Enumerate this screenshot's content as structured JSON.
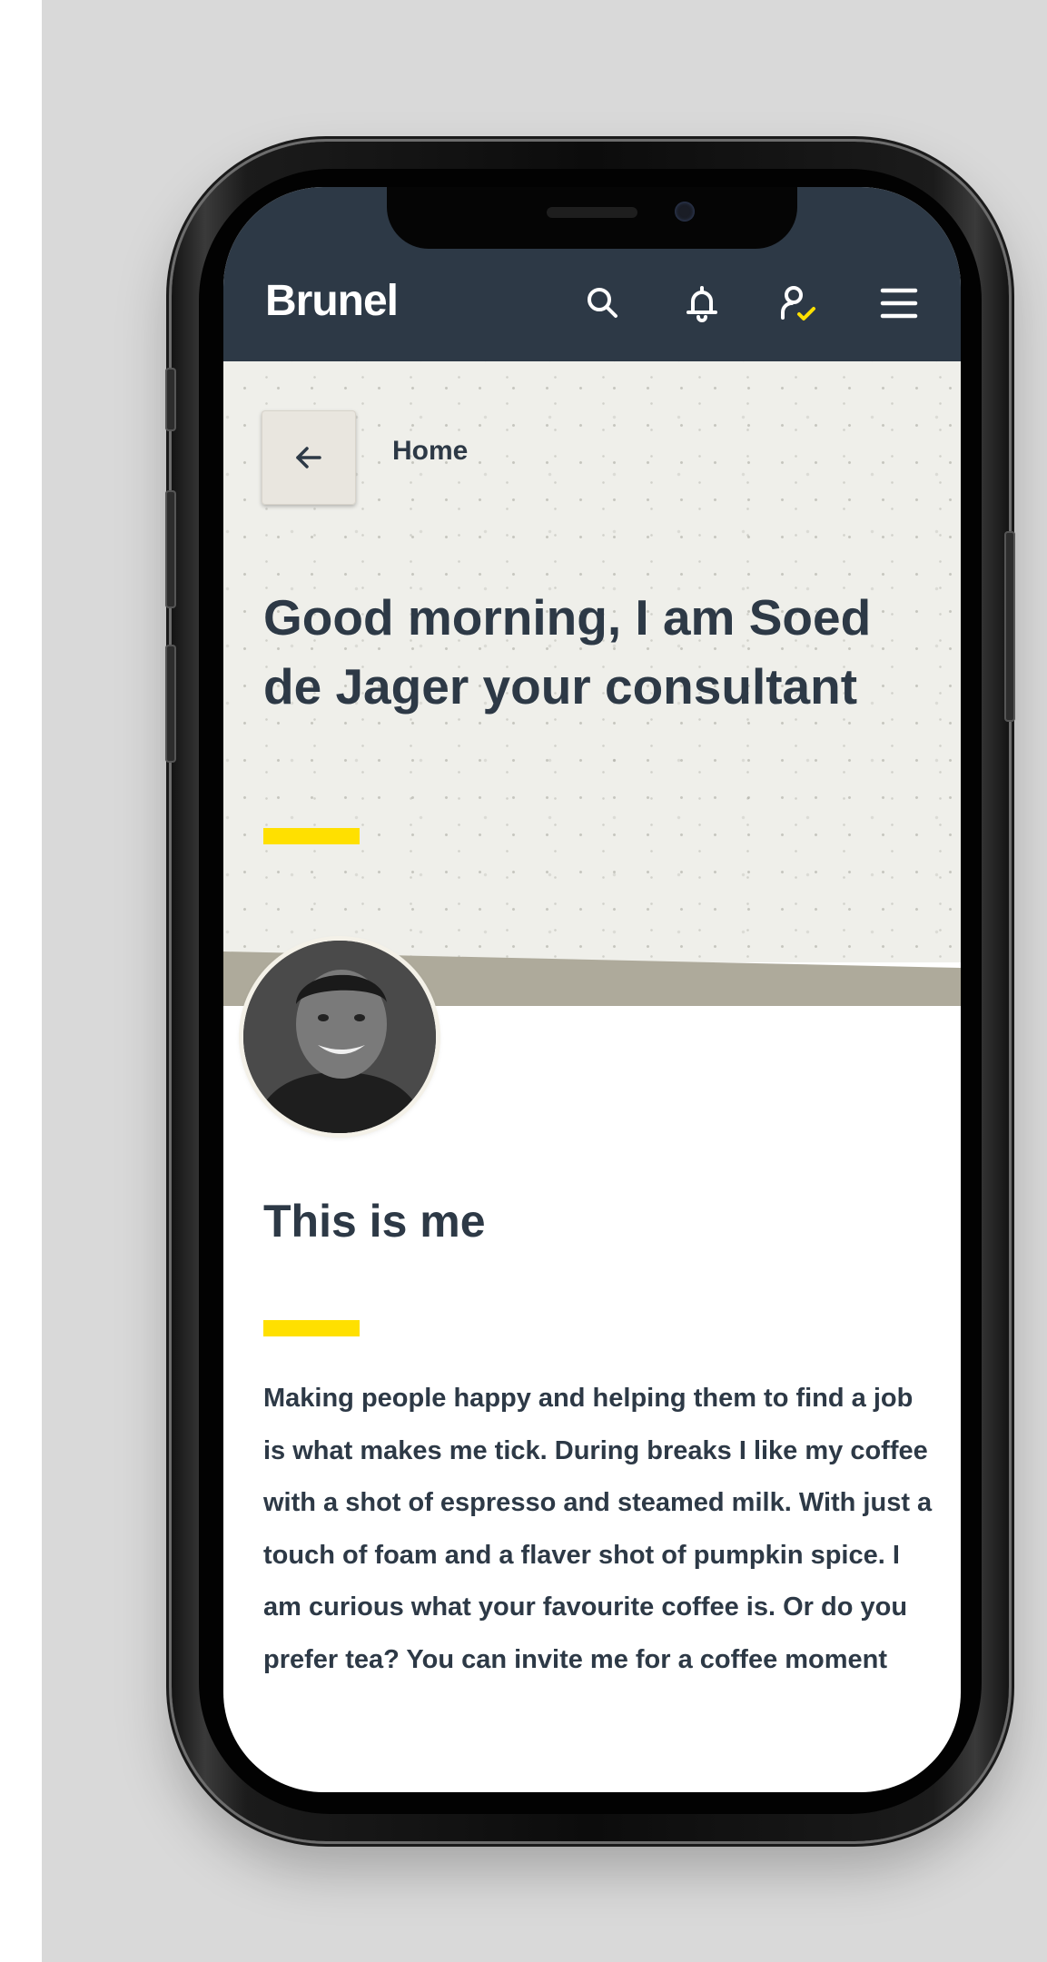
{
  "header": {
    "logo_text": "Brunel",
    "icons": [
      "search-icon",
      "bell-icon",
      "profile-check-icon",
      "menu-icon"
    ],
    "background_color": "#2d3946",
    "accent_color": "#ffe000"
  },
  "breadcrumb": {
    "back_icon": "arrow-left-icon",
    "label": "Home"
  },
  "hero": {
    "greeting": "Good morning, I am Soed de Jager your consultant"
  },
  "profile": {
    "avatar": "consultant-photo"
  },
  "about": {
    "title": "This is me",
    "body": "Making people happy and helping them to find a job is what makes me tick. During breaks I like my coffee with a shot of espresso and steamed milk. With just a touch of foam and a flaver shot of pumpkin spice. I am curious what your favourite coffee is. Or do you prefer tea? You can invite me for a coffee moment"
  }
}
